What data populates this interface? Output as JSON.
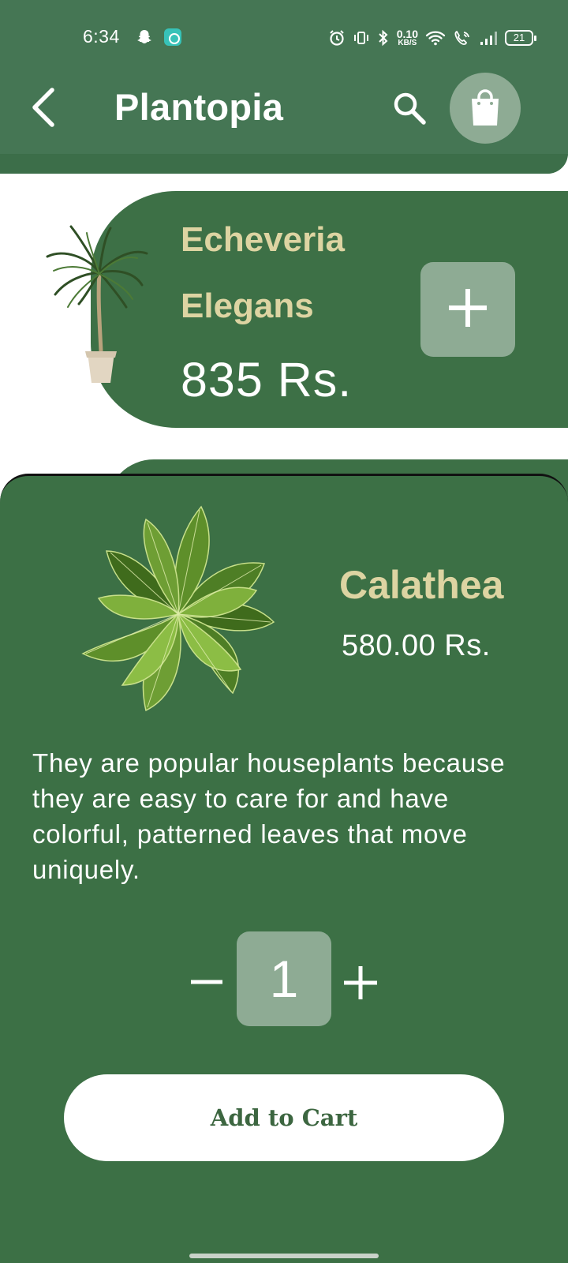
{
  "status_bar": {
    "time": "6:34",
    "net_speed_value": "0.10",
    "net_speed_unit": "KB/S",
    "battery_level": "21",
    "icons": [
      "snapchat-icon",
      "app-notification-icon",
      "alarm-icon",
      "vibrate-icon",
      "bluetooth-icon",
      "wifi-icon",
      "wifi-calling-icon",
      "signal-icon",
      "battery-icon"
    ]
  },
  "app_bar": {
    "title": "Plantopia",
    "icons": [
      "back-arrow-icon",
      "search-icon",
      "shopping-bag-icon"
    ]
  },
  "product_card": {
    "name_line1": "Echeveria",
    "name_line2": "Elegans",
    "price": "835 Rs.",
    "add_icon": "plus-icon"
  },
  "detail_sheet": {
    "name": "Calathea",
    "price": "580.00 Rs.",
    "description": "They are popular houseplants because they are easy to care for and have colorful, patterned leaves that move uniquely.",
    "quantity": "1",
    "add_to_cart_label": "Add to Cart"
  },
  "colors": {
    "app_bar": "#457654",
    "card_green": "#3d7046",
    "accent_button": "#8eab94",
    "plant_name": "#ddd4a2",
    "button_text": "#3c6640"
  }
}
